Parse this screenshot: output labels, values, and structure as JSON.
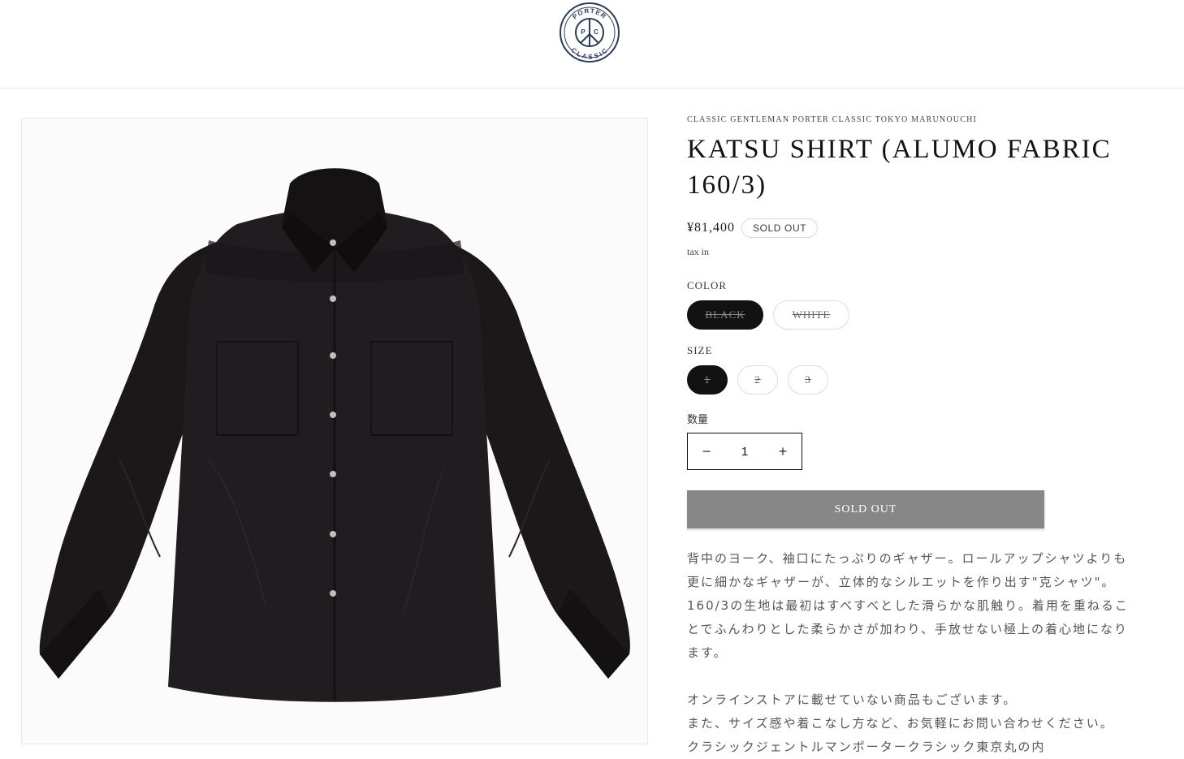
{
  "header": {
    "logo_text_top": "PORTER",
    "logo_text_bottom": "CLASSIC",
    "logo_initials": [
      "P",
      "C"
    ]
  },
  "product": {
    "vendor": "CLASSIC GENTLEMAN PORTER CLASSIC TOKYO MARUNOUCHI",
    "title_line1": "KATSU SHIRT (ALUMO FABRIC",
    "title_line2": "160/3)",
    "price": "¥81,400",
    "badge": "SOLD OUT",
    "tax": "tax in",
    "color_label": "COLOR",
    "colors": [
      "BLACK",
      "WHITE"
    ],
    "selected_color": "BLACK",
    "size_label": "SIZE",
    "sizes": [
      "1",
      "2",
      "3"
    ],
    "selected_size": "1",
    "quantity_label": "数量",
    "quantity": "1",
    "minus": "−",
    "plus": "+",
    "button_label": "SOLD OUT",
    "description": [
      "背中のヨーク、袖口にたっぷりのギャザー。ロールアップシャツよりも",
      "更に細かなギャザーが、立体的なシルエットを作り出す\"克シャツ\"。",
      "160/3の生地は最初はすべすべとした滑らかな肌触り。着用を重ねるこ",
      "とでふんわりとした柔らかさが加わり、手放せない極上の着心地になり",
      "ます。"
    ],
    "description2": [
      "オンラインストアに載せていない商品もございます。",
      "また、サイズ感や着こなし方など、お気軽にお問い合わせください。",
      "クラシックジェントルマンポータークラシック東京丸の内"
    ]
  },
  "colors": {
    "accent_dark": "#121212",
    "button_disabled": "#878787",
    "shirt": "#1f1b1d"
  },
  "icons": {
    "logo": "peace-sign-circle-logo",
    "minus": "minus-icon",
    "plus": "plus-icon"
  }
}
